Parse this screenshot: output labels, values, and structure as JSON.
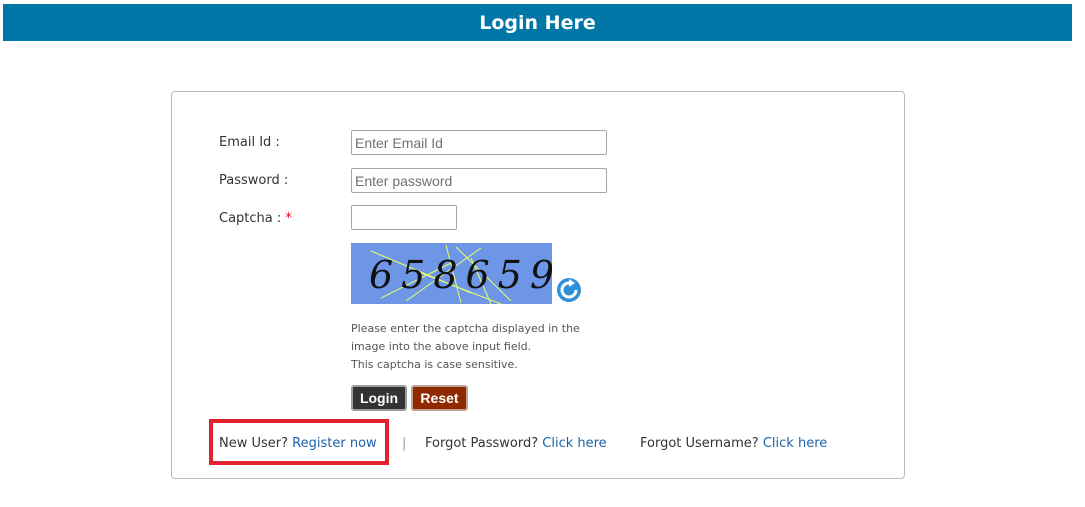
{
  "header": {
    "title": "Login Here"
  },
  "form": {
    "email_label": "Email Id :",
    "email_placeholder": "Enter Email Id",
    "password_label": "Password :",
    "password_placeholder": "Enter password",
    "captcha_label": "Captcha :",
    "captcha_required_mark": "*",
    "captcha_value": "",
    "captcha_image_text": "658659",
    "captcha_hint_line1": "Please enter the captcha displayed in the",
    "captcha_hint_line2": "image into the above input field.",
    "captcha_hint_line3": "This captcha is case sensitive.",
    "login_button": "Login",
    "reset_button": "Reset"
  },
  "links": {
    "new_user_text": "New User?",
    "register_link": "Register now",
    "separator": "|",
    "forgot_password_text": "Forgot Password?",
    "forgot_password_link": "Click here",
    "forgot_username_text": "Forgot Username?",
    "forgot_username_link": "Click here"
  },
  "colors": {
    "header_bg": "#0077a6",
    "link": "#1a63a8",
    "login_button": "#333333",
    "reset_button": "#8f2a00",
    "highlight": "#e0232f"
  },
  "icons": {
    "refresh": "refresh-icon"
  }
}
